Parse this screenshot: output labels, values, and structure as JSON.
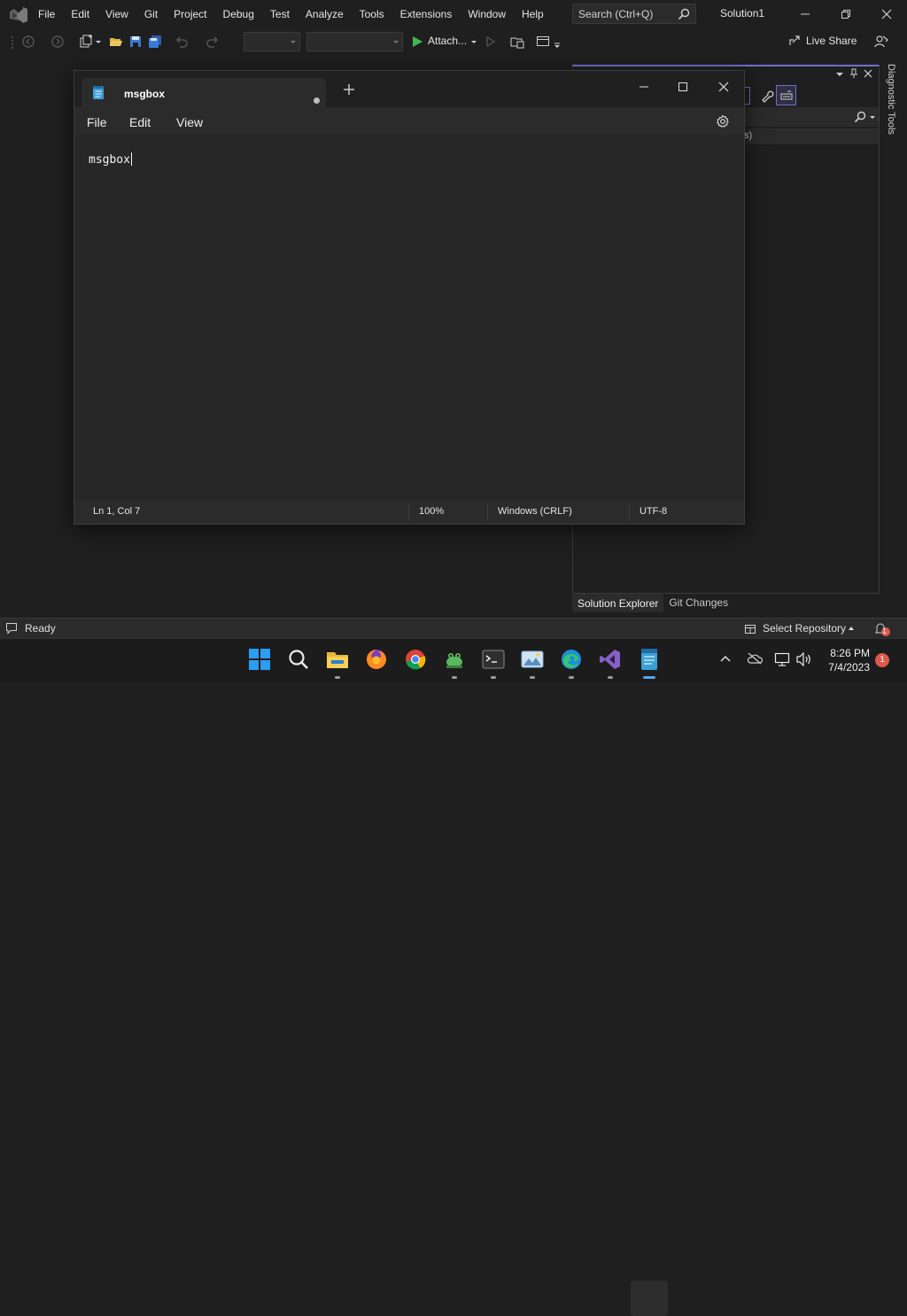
{
  "vs": {
    "menu": [
      "File",
      "Edit",
      "View",
      "Git",
      "Project",
      "Debug",
      "Test",
      "Analyze",
      "Tools",
      "Extensions",
      "Window",
      "Help"
    ],
    "search_placeholder": "Search (Ctrl+Q)",
    "solution_name": "Solution1",
    "attach_label": "Attach...",
    "live_share_label": "Live Share",
    "side_tab_label": "Diagnostic Tools",
    "panel_subrow_text": "s)",
    "panel_tabs": [
      "Solution Explorer",
      "Git Changes"
    ],
    "status_ready": "Ready",
    "status_repo": "Select Repository",
    "notification_count": "1",
    "accent_color": "#7070c8"
  },
  "notepad": {
    "tab_title": "msgbox",
    "menu": [
      "File",
      "Edit",
      "View"
    ],
    "content": "msgbox",
    "status": {
      "position": "Ln 1, Col 7",
      "zoom": "100%",
      "line_ending": "Windows (CRLF)",
      "encoding": "UTF-8"
    }
  },
  "taskbar": {
    "icons": [
      "windows-start-icon",
      "search-icon",
      "file-explorer-icon",
      "firefox-icon",
      "chrome-icon",
      "frog-app-icon",
      "terminal-icon",
      "photos-icon",
      "edge-icon",
      "visual-studio-icon",
      "notepad-icon"
    ],
    "time": "8:26 PM",
    "date": "7/4/2023",
    "notification_count": "1"
  }
}
